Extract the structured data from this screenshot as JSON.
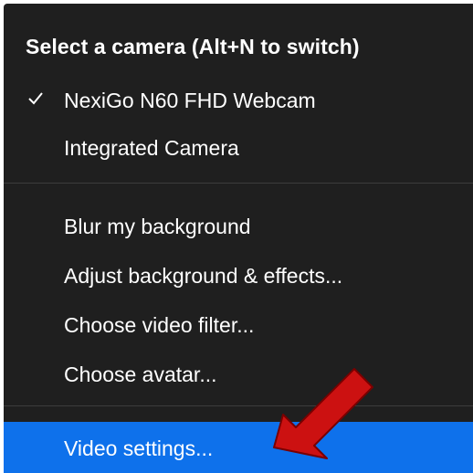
{
  "menu": {
    "header": "Select a camera (Alt+N to switch)",
    "cameras": [
      {
        "label": "NexiGo N60 FHD Webcam",
        "checked": true
      },
      {
        "label": "Integrated Camera",
        "checked": false
      }
    ],
    "options": [
      {
        "label": "Blur my background"
      },
      {
        "label": "Adjust background & effects..."
      },
      {
        "label": "Choose video filter..."
      },
      {
        "label": "Choose avatar..."
      }
    ],
    "settings": {
      "label": "Video settings...",
      "highlighted": true
    }
  },
  "colors": {
    "menu_background": "#1f1f1f",
    "highlight": "#0e71eb",
    "arrow": "#cc1111",
    "text": "#ffffff"
  },
  "icons": {
    "check": "check-icon",
    "arrow": "red-arrow-annotation-icon"
  }
}
